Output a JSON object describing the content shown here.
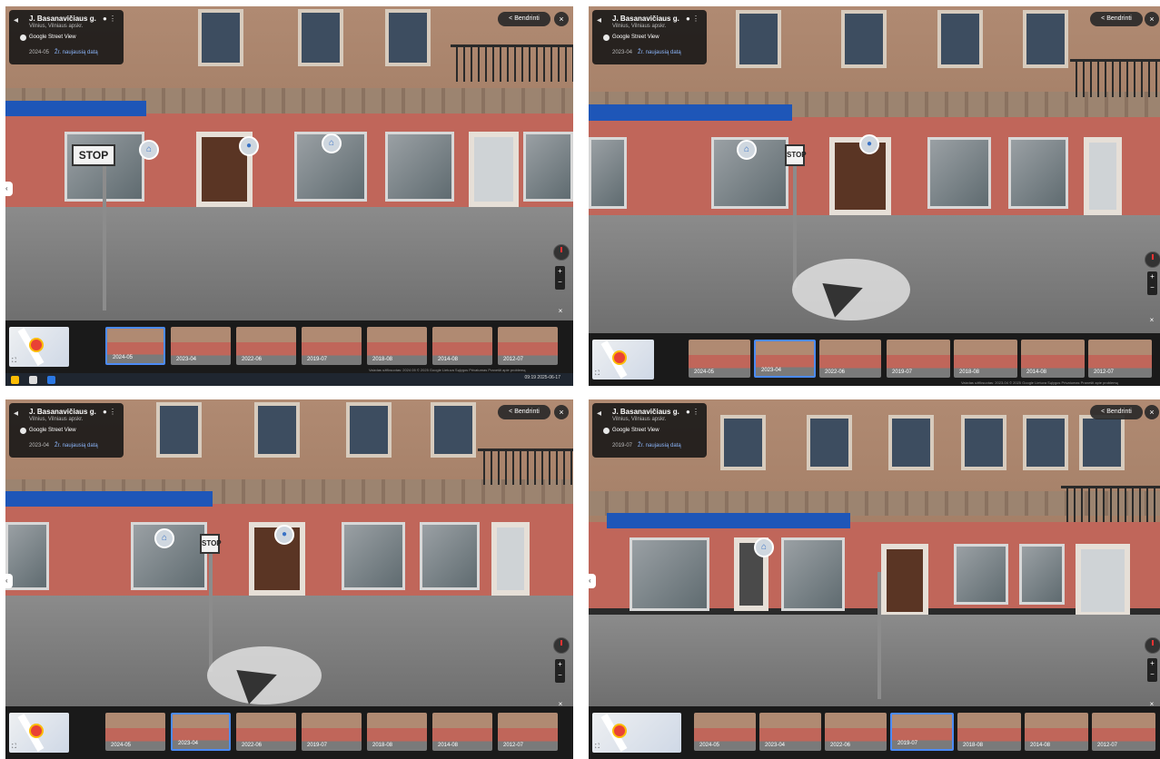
{
  "panels": [
    {
      "id": "top-left",
      "info": {
        "title": "J. Basanavičiaus g.",
        "subtitle": "Vilnius, Vilniaus apskr.",
        "source": "Google Street View",
        "date": "2024-05",
        "latest_link": "Žr. naujausią datą"
      },
      "share_label": "Bendrinti",
      "selected_date": "2024-05",
      "footer": "Vaizdas užfiksuotas: 2024 05   © 2025 Google   Lietuva   Sąlygos   Privatumas   Pranešti apie problemą",
      "taskbar": {
        "time": "09:19",
        "date": "2025-06-17"
      }
    },
    {
      "id": "top-right",
      "info": {
        "title": "J. Basanavičiaus g.",
        "subtitle": "Vilnius, Vilniaus apskr.",
        "source": "Google Street View",
        "date": "2023-04",
        "latest_link": "Žr. naujausią datą"
      },
      "share_label": "Bendrinti",
      "selected_date": "2023-04",
      "footer": "Vaizdas užfiksuotas: 2023-04   © 2025 Google   Lietuva   Sąlygos   Privatumas   Pranešti apie problemą"
    },
    {
      "id": "bottom-left",
      "info": {
        "title": "J. Basanavičiaus g.",
        "subtitle": "Vilnius, Vilniaus apskr.",
        "source": "Google Street View",
        "date": "2023-04",
        "latest_link": "Žr. naujausią datą"
      },
      "share_label": "Bendrinti",
      "selected_date": "2023-04"
    },
    {
      "id": "bottom-right",
      "info": {
        "title": "J. Basanavičiaus g.",
        "subtitle": "Vilnius, Vilniaus apskr.",
        "source": "Google Street View",
        "date": "2019-07",
        "latest_link": "Žr. naujausią datą"
      },
      "share_label": "Bendrinti",
      "selected_date": "2019-07"
    }
  ],
  "timeline_dates": [
    "2024-05",
    "2023-04",
    "2022-06",
    "2019-07",
    "2018-08",
    "2014-08",
    "2012-07"
  ],
  "street_signs": {
    "stop": "STOP"
  },
  "colors": {
    "accent": "#4c8bf5",
    "sign_blue": "#1e56b8",
    "facade": "#c0665a"
  },
  "icons": [
    "back-icon",
    "pin-icon",
    "more-icon",
    "share-icon",
    "close-icon",
    "compass-icon",
    "zoom-in-icon",
    "zoom-out-icon",
    "expand-icon",
    "nav-arrow-icon"
  ]
}
